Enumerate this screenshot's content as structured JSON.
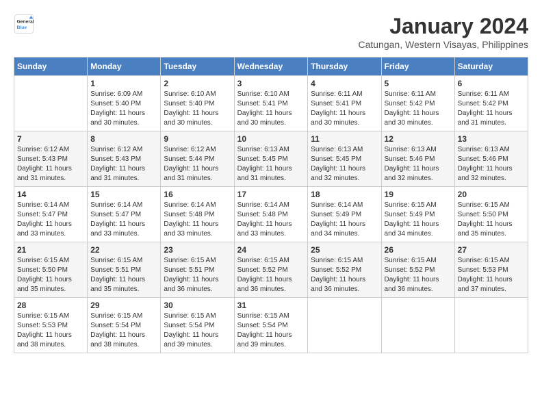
{
  "logo": {
    "line1": "General",
    "line2": "Blue"
  },
  "title": "January 2024",
  "subtitle": "Catungan, Western Visayas, Philippines",
  "days_of_week": [
    "Sunday",
    "Monday",
    "Tuesday",
    "Wednesday",
    "Thursday",
    "Friday",
    "Saturday"
  ],
  "weeks": [
    [
      {
        "day": "",
        "sunrise": "",
        "sunset": "",
        "daylight": ""
      },
      {
        "day": "1",
        "sunrise": "Sunrise: 6:09 AM",
        "sunset": "Sunset: 5:40 PM",
        "daylight": "Daylight: 11 hours and 30 minutes."
      },
      {
        "day": "2",
        "sunrise": "Sunrise: 6:10 AM",
        "sunset": "Sunset: 5:40 PM",
        "daylight": "Daylight: 11 hours and 30 minutes."
      },
      {
        "day": "3",
        "sunrise": "Sunrise: 6:10 AM",
        "sunset": "Sunset: 5:41 PM",
        "daylight": "Daylight: 11 hours and 30 minutes."
      },
      {
        "day": "4",
        "sunrise": "Sunrise: 6:11 AM",
        "sunset": "Sunset: 5:41 PM",
        "daylight": "Daylight: 11 hours and 30 minutes."
      },
      {
        "day": "5",
        "sunrise": "Sunrise: 6:11 AM",
        "sunset": "Sunset: 5:42 PM",
        "daylight": "Daylight: 11 hours and 30 minutes."
      },
      {
        "day": "6",
        "sunrise": "Sunrise: 6:11 AM",
        "sunset": "Sunset: 5:42 PM",
        "daylight": "Daylight: 11 hours and 31 minutes."
      }
    ],
    [
      {
        "day": "7",
        "sunrise": "Sunrise: 6:12 AM",
        "sunset": "Sunset: 5:43 PM",
        "daylight": "Daylight: 11 hours and 31 minutes."
      },
      {
        "day": "8",
        "sunrise": "Sunrise: 6:12 AM",
        "sunset": "Sunset: 5:43 PM",
        "daylight": "Daylight: 11 hours and 31 minutes."
      },
      {
        "day": "9",
        "sunrise": "Sunrise: 6:12 AM",
        "sunset": "Sunset: 5:44 PM",
        "daylight": "Daylight: 11 hours and 31 minutes."
      },
      {
        "day": "10",
        "sunrise": "Sunrise: 6:13 AM",
        "sunset": "Sunset: 5:45 PM",
        "daylight": "Daylight: 11 hours and 31 minutes."
      },
      {
        "day": "11",
        "sunrise": "Sunrise: 6:13 AM",
        "sunset": "Sunset: 5:45 PM",
        "daylight": "Daylight: 11 hours and 32 minutes."
      },
      {
        "day": "12",
        "sunrise": "Sunrise: 6:13 AM",
        "sunset": "Sunset: 5:46 PM",
        "daylight": "Daylight: 11 hours and 32 minutes."
      },
      {
        "day": "13",
        "sunrise": "Sunrise: 6:13 AM",
        "sunset": "Sunset: 5:46 PM",
        "daylight": "Daylight: 11 hours and 32 minutes."
      }
    ],
    [
      {
        "day": "14",
        "sunrise": "Sunrise: 6:14 AM",
        "sunset": "Sunset: 5:47 PM",
        "daylight": "Daylight: 11 hours and 33 minutes."
      },
      {
        "day": "15",
        "sunrise": "Sunrise: 6:14 AM",
        "sunset": "Sunset: 5:47 PM",
        "daylight": "Daylight: 11 hours and 33 minutes."
      },
      {
        "day": "16",
        "sunrise": "Sunrise: 6:14 AM",
        "sunset": "Sunset: 5:48 PM",
        "daylight": "Daylight: 11 hours and 33 minutes."
      },
      {
        "day": "17",
        "sunrise": "Sunrise: 6:14 AM",
        "sunset": "Sunset: 5:48 PM",
        "daylight": "Daylight: 11 hours and 33 minutes."
      },
      {
        "day": "18",
        "sunrise": "Sunrise: 6:14 AM",
        "sunset": "Sunset: 5:49 PM",
        "daylight": "Daylight: 11 hours and 34 minutes."
      },
      {
        "day": "19",
        "sunrise": "Sunrise: 6:15 AM",
        "sunset": "Sunset: 5:49 PM",
        "daylight": "Daylight: 11 hours and 34 minutes."
      },
      {
        "day": "20",
        "sunrise": "Sunrise: 6:15 AM",
        "sunset": "Sunset: 5:50 PM",
        "daylight": "Daylight: 11 hours and 35 minutes."
      }
    ],
    [
      {
        "day": "21",
        "sunrise": "Sunrise: 6:15 AM",
        "sunset": "Sunset: 5:50 PM",
        "daylight": "Daylight: 11 hours and 35 minutes."
      },
      {
        "day": "22",
        "sunrise": "Sunrise: 6:15 AM",
        "sunset": "Sunset: 5:51 PM",
        "daylight": "Daylight: 11 hours and 35 minutes."
      },
      {
        "day": "23",
        "sunrise": "Sunrise: 6:15 AM",
        "sunset": "Sunset: 5:51 PM",
        "daylight": "Daylight: 11 hours and 36 minutes."
      },
      {
        "day": "24",
        "sunrise": "Sunrise: 6:15 AM",
        "sunset": "Sunset: 5:52 PM",
        "daylight": "Daylight: 11 hours and 36 minutes."
      },
      {
        "day": "25",
        "sunrise": "Sunrise: 6:15 AM",
        "sunset": "Sunset: 5:52 PM",
        "daylight": "Daylight: 11 hours and 36 minutes."
      },
      {
        "day": "26",
        "sunrise": "Sunrise: 6:15 AM",
        "sunset": "Sunset: 5:52 PM",
        "daylight": "Daylight: 11 hours and 36 minutes."
      },
      {
        "day": "27",
        "sunrise": "Sunrise: 6:15 AM",
        "sunset": "Sunset: 5:53 PM",
        "daylight": "Daylight: 11 hours and 37 minutes."
      }
    ],
    [
      {
        "day": "28",
        "sunrise": "Sunrise: 6:15 AM",
        "sunset": "Sunset: 5:53 PM",
        "daylight": "Daylight: 11 hours and 38 minutes."
      },
      {
        "day": "29",
        "sunrise": "Sunrise: 6:15 AM",
        "sunset": "Sunset: 5:54 PM",
        "daylight": "Daylight: 11 hours and 38 minutes."
      },
      {
        "day": "30",
        "sunrise": "Sunrise: 6:15 AM",
        "sunset": "Sunset: 5:54 PM",
        "daylight": "Daylight: 11 hours and 39 minutes."
      },
      {
        "day": "31",
        "sunrise": "Sunrise: 6:15 AM",
        "sunset": "Sunset: 5:54 PM",
        "daylight": "Daylight: 11 hours and 39 minutes."
      },
      {
        "day": "",
        "sunrise": "",
        "sunset": "",
        "daylight": ""
      },
      {
        "day": "",
        "sunrise": "",
        "sunset": "",
        "daylight": ""
      },
      {
        "day": "",
        "sunrise": "",
        "sunset": "",
        "daylight": ""
      }
    ]
  ]
}
